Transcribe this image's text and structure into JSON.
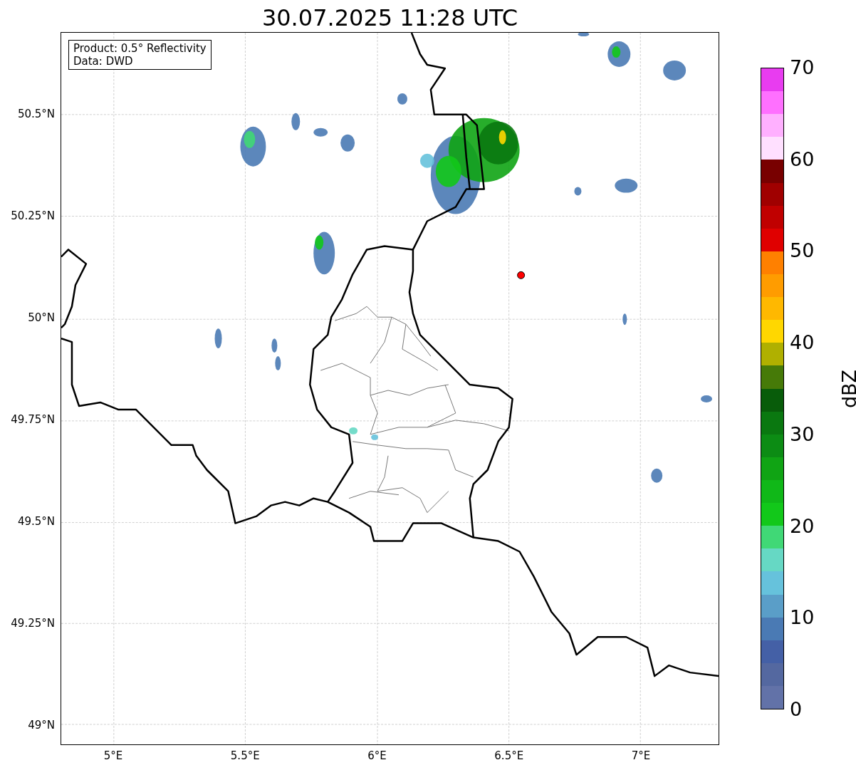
{
  "title": "30.07.2025 11:28 UTC",
  "legend": {
    "lines": [
      "Product: 0.5° Reflectivity",
      "Data: DWD"
    ]
  },
  "lat_ticks": [
    "50.5°N",
    "50.25°N",
    "50°N",
    "49.75°N",
    "49.5°N",
    "49.25°N",
    "49°N"
  ],
  "lon_ticks": [
    "5°E",
    "5.5°E",
    "6°E",
    "6.5°E",
    "7°E"
  ],
  "colorbar": {
    "ticks": [
      "70",
      "60",
      "50",
      "40",
      "30",
      "20",
      "10",
      "0"
    ],
    "label": "dBZ",
    "bins": [
      {
        "color": "#e83cf0"
      },
      {
        "color": "#ff70ff"
      },
      {
        "color": "#ffb0ff"
      },
      {
        "color": "#ffe0ff"
      },
      {
        "color": "#780000"
      },
      {
        "color": "#a00000"
      },
      {
        "color": "#c00000"
      },
      {
        "color": "#e00000"
      },
      {
        "color": "#ff8000"
      },
      {
        "color": "#ff9c00"
      },
      {
        "color": "#ffb800"
      },
      {
        "color": "#ffd700"
      },
      {
        "color": "#b0b000"
      },
      {
        "color": "#467a08"
      },
      {
        "color": "#085c0a"
      },
      {
        "color": "#0a7810"
      },
      {
        "color": "#0c8c14"
      },
      {
        "color": "#10a414"
      },
      {
        "color": "#10b818"
      },
      {
        "color": "#12c81a"
      },
      {
        "color": "#40d876"
      },
      {
        "color": "#66d8c4"
      },
      {
        "color": "#66c2dc"
      },
      {
        "color": "#5a9ec8"
      },
      {
        "color": "#4a7ab4"
      },
      {
        "color": "#4460a6"
      },
      {
        "color": "#5468a0"
      },
      {
        "color": "#6272a8"
      }
    ]
  }
}
